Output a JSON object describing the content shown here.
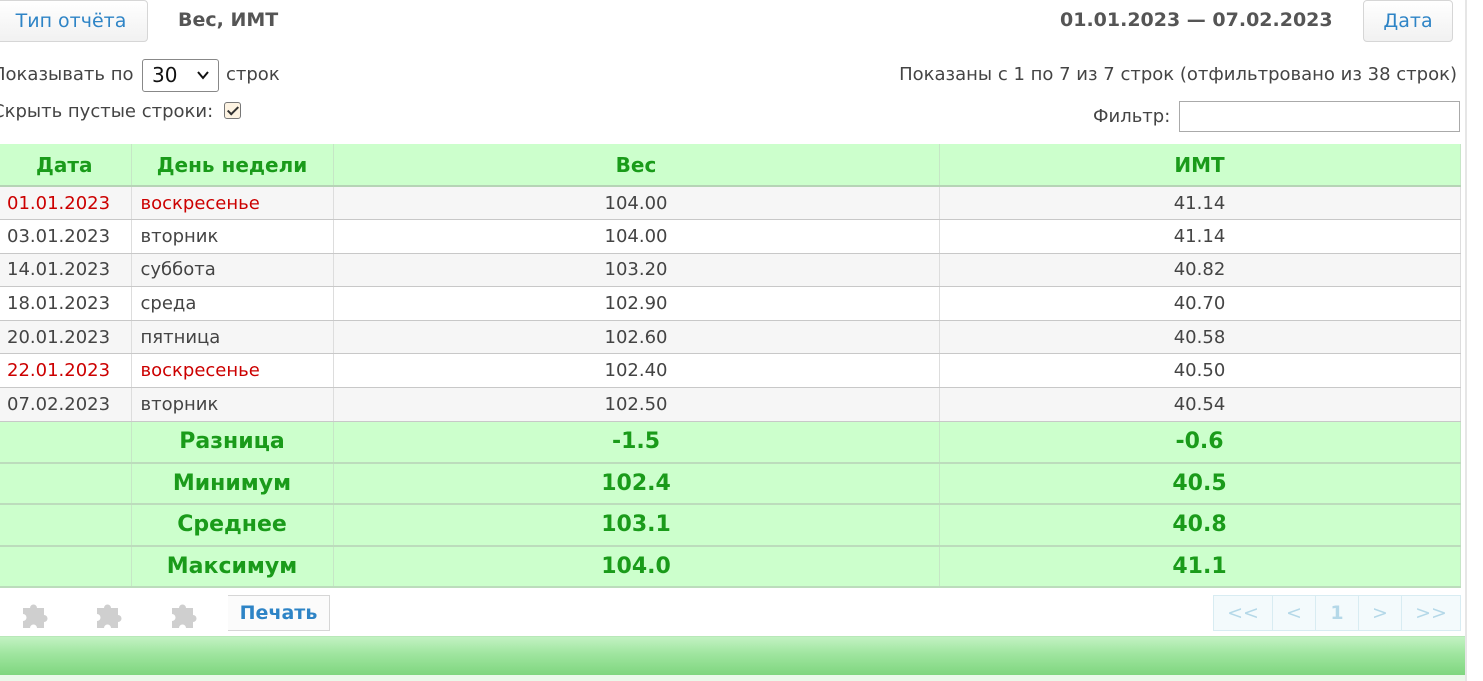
{
  "header": {
    "report_type_button": "Тип отчёта",
    "report_name": "Вес, ИМТ",
    "date_range": "01.01.2023 — 07.02.2023",
    "date_button": "Дата"
  },
  "controls": {
    "show_label": "Показывать по",
    "rows_per_page": "30",
    "rows_label": "строк",
    "hide_empty_label": "Скрыть пустые строки:",
    "hide_empty_checked": true,
    "info_text": "Показаны с 1 по 7 из 7 строк (отфильтровано из 38 строк)",
    "filter_label": "Фильтр:",
    "filter_value": ""
  },
  "table": {
    "columns": [
      "Дата",
      "День недели",
      "Вес",
      "ИМТ"
    ],
    "rows": [
      {
        "date": "01.01.2023",
        "day": "воскресенье",
        "weight": "104.00",
        "bmi": "41.14",
        "weekend": true
      },
      {
        "date": "03.01.2023",
        "day": "вторник",
        "weight": "104.00",
        "bmi": "41.14",
        "weekend": false
      },
      {
        "date": "14.01.2023",
        "day": "суббота",
        "weight": "103.20",
        "bmi": "40.82",
        "weekend": false
      },
      {
        "date": "18.01.2023",
        "day": "среда",
        "weight": "102.90",
        "bmi": "40.70",
        "weekend": false
      },
      {
        "date": "20.01.2023",
        "day": "пятница",
        "weight": "102.60",
        "bmi": "40.58",
        "weekend": false
      },
      {
        "date": "22.01.2023",
        "day": "воскресенье",
        "weight": "102.40",
        "bmi": "40.50",
        "weekend": true
      },
      {
        "date": "07.02.2023",
        "day": "вторник",
        "weight": "102.50",
        "bmi": "40.54",
        "weekend": false
      }
    ],
    "summary": [
      {
        "label": "Разница",
        "weight": "-1.5",
        "bmi": "-0.6"
      },
      {
        "label": "Минимум",
        "weight": "102.4",
        "bmi": "40.5"
      },
      {
        "label": "Среднее",
        "weight": "103.1",
        "bmi": "40.8"
      },
      {
        "label": "Максимум",
        "weight": "104.0",
        "bmi": "41.1"
      }
    ]
  },
  "toolbar": {
    "plugin_icons": [
      "puzzle-icon",
      "puzzle-icon",
      "puzzle-icon"
    ],
    "print_label": "Печать"
  },
  "pager": {
    "first": "<<",
    "prev": "<",
    "current": "1",
    "next": ">",
    "last": ">>"
  },
  "colors": {
    "accent_link": "#2e84c6",
    "header_green_bg": "#ccffcc",
    "header_green_text": "#1a9b1a",
    "weekend_red": "#cc0000"
  }
}
